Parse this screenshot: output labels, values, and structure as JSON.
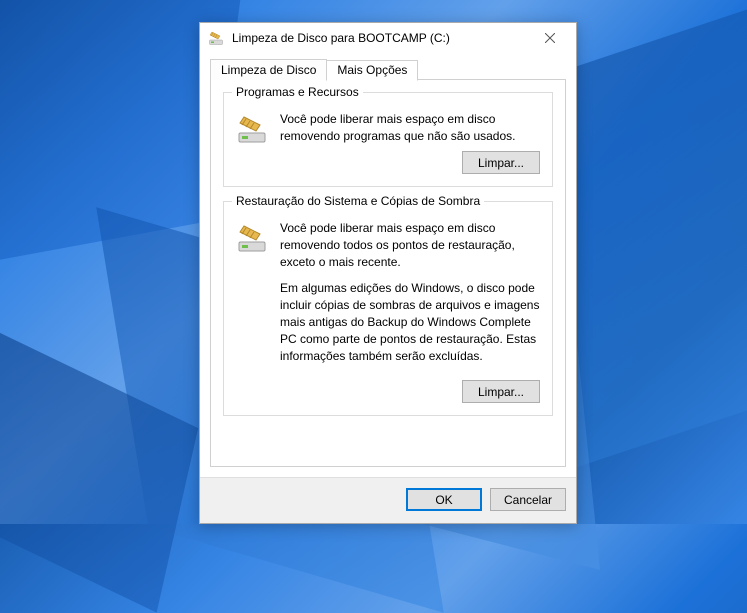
{
  "titlebar": {
    "title": "Limpeza de Disco para BOOTCAMP (C:)"
  },
  "tabs": {
    "cleanup": "Limpeza de Disco",
    "more": "Mais Opções"
  },
  "groups": {
    "programs": {
      "legend": "Programas e Recursos",
      "text": "Você pode liberar mais espaço em disco removendo programas que não são usados.",
      "button": "Limpar..."
    },
    "restore": {
      "legend": "Restauração do Sistema e Cópias de Sombra",
      "text1": "Você pode liberar mais espaço em disco removendo todos os pontos de restauração, exceto o mais recente.",
      "text2": "Em algumas edições do Windows, o disco pode incluir cópias de sombras de arquivos e imagens mais antigas do Backup do Windows Complete PC como parte de pontos de restauração. Estas informações também serão excluídas.",
      "button": "Limpar..."
    }
  },
  "footer": {
    "ok": "OK",
    "cancel": "Cancelar"
  }
}
